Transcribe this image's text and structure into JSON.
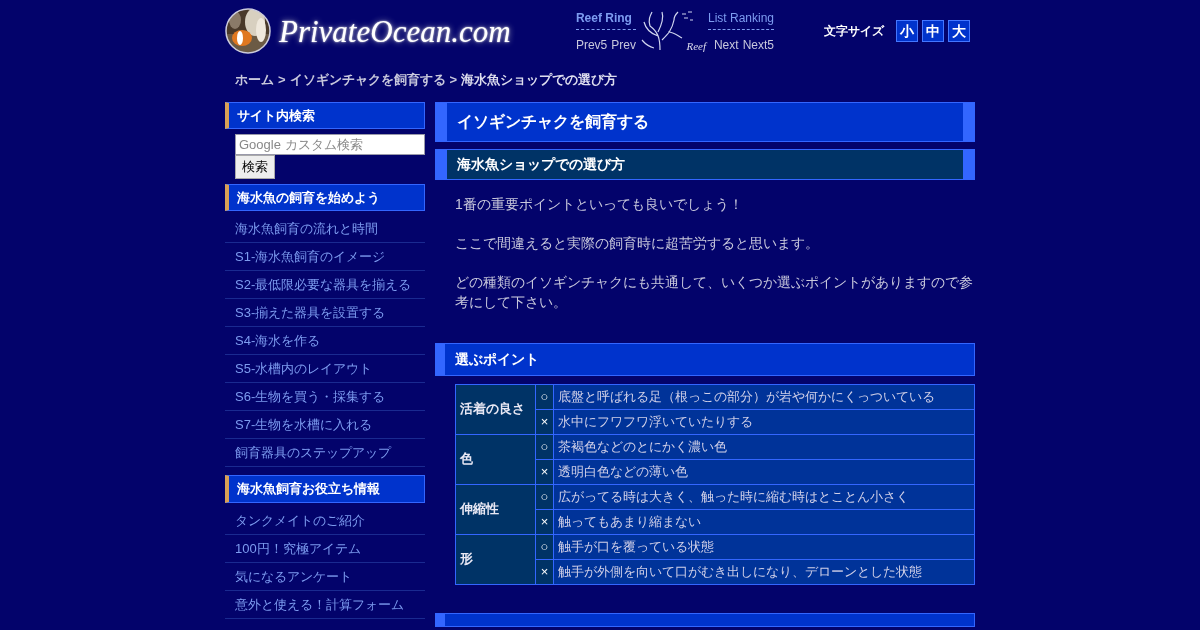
{
  "header": {
    "logo_text": "PrivateOcean.com",
    "reef_ring": {
      "title": "Reef Ring",
      "list": "List Ranking",
      "prev5": "Prev5",
      "prev": "Prev",
      "next": "Next",
      "next5": "Next5",
      "badge": "Reef"
    },
    "font_size": {
      "label": "文字サイズ",
      "buttons": [
        "小",
        "中",
        "大"
      ]
    }
  },
  "breadcrumb": {
    "separator": ">",
    "items": [
      {
        "text": "ホーム",
        "link": true
      },
      {
        "text": "イソギンチャクを飼育する",
        "link": true
      },
      {
        "text": "海水魚ショップでの選び方",
        "link": false
      }
    ]
  },
  "sidebar": [
    {
      "kind": "search",
      "title": "サイト内検索",
      "placeholder": "Google カスタム検索",
      "button": "検索"
    },
    {
      "kind": "links",
      "title": "海水魚の飼育を始めよう",
      "items": [
        "海水魚飼育の流れと時間",
        "S1-海水魚飼育のイメージ",
        "S2-最低限必要な器具を揃える",
        "S3-揃えた器具を設置する",
        "S4-海水を作る",
        "S5-水槽内のレイアウト",
        "S6-生物を買う・採集する",
        "S7-生物を水槽に入れる",
        "飼育器具のステップアップ"
      ]
    },
    {
      "kind": "links",
      "title": "海水魚飼育お役立ち情報",
      "items": [
        "タンクメイトのご紹介",
        "100円！究極アイテム",
        "気になるアンケート",
        "意外と使える！計算フォーム"
      ]
    }
  ],
  "main": {
    "title": "イソギンチャクを飼育する",
    "subtitle": "海水魚ショップでの選び方",
    "paragraphs": [
      "1番の重要ポイントといっても良いでしょう！",
      "ここで間違えると実際の飼育時に超苦労すると思います。",
      "どの種類のイソギンチャクにも共通して、いくつか選ぶポイントがありますので参考にして下さい。"
    ],
    "points_heading": "選ぶポイント",
    "points_table": [
      {
        "label": "活着の良さ",
        "rows": [
          {
            "mark": "○",
            "text": "底盤と呼ばれる足（根っこの部分）が岩や何かにくっついている"
          },
          {
            "mark": "×",
            "text": "水中にフワフワ浮いていたりする"
          }
        ]
      },
      {
        "label": "色",
        "rows": [
          {
            "mark": "○",
            "text": "茶褐色などのとにかく濃い色"
          },
          {
            "mark": "×",
            "text": "透明白色などの薄い色"
          }
        ]
      },
      {
        "label": "伸縮性",
        "rows": [
          {
            "mark": "○",
            "text": "広がってる時は大きく、触った時に縮む時はとことん小さく"
          },
          {
            "mark": "×",
            "text": "触ってもあまり縮まない"
          }
        ]
      },
      {
        "label": "形",
        "rows": [
          {
            "mark": "○",
            "text": "触手が口を覆っている状態"
          },
          {
            "mark": "×",
            "text": "触手が外側を向いて口がむき出しになり、デローンとした状態"
          }
        ]
      }
    ],
    "next_heading_bar": true
  }
}
